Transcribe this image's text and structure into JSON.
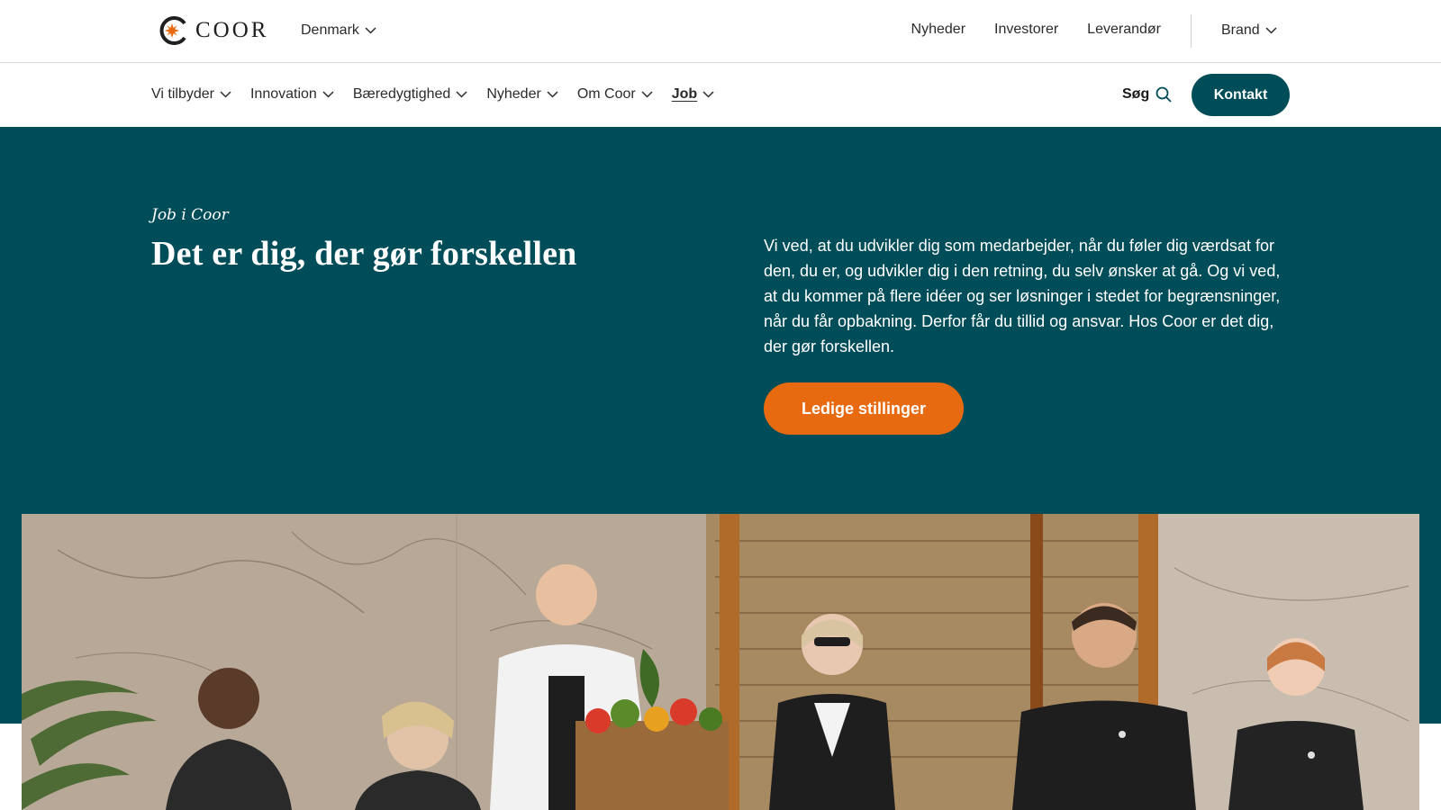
{
  "header": {
    "logo_text": "COOR",
    "country": "Denmark",
    "util_links": [
      "Nyheder",
      "Investorer",
      "Leverandør"
    ],
    "brand": "Brand"
  },
  "nav": {
    "items": [
      {
        "label": "Vi tilbyder"
      },
      {
        "label": "Innovation"
      },
      {
        "label": "Bæredygtighed"
      },
      {
        "label": "Nyheder"
      },
      {
        "label": "Om Coor"
      },
      {
        "label": "Job"
      }
    ],
    "active": "Job",
    "search_label": "Søg",
    "contact_label": "Kontakt"
  },
  "hero": {
    "eyebrow": "Job i Coor",
    "title": "Det er dig, der gør forskellen",
    "text": "Vi ved, at du udvikler dig som medarbejder, når du føler dig værdsat for den, du er, og udvikler dig i den retning, du selv ønsker at gå. Og vi ved, at du kommer på flere idéer og ser løsninger i stedet for begrænsninger, når du får opbakning. Derfor får du tillid og ansvar. Hos Coor er det dig, der gør forskellen.",
    "cta_label": "Ledige stillinger"
  },
  "colors": {
    "teal": "#004d5a",
    "orange": "#e86a10"
  },
  "icons": {
    "search": "search-icon",
    "chevron": "chevron-down-icon"
  }
}
